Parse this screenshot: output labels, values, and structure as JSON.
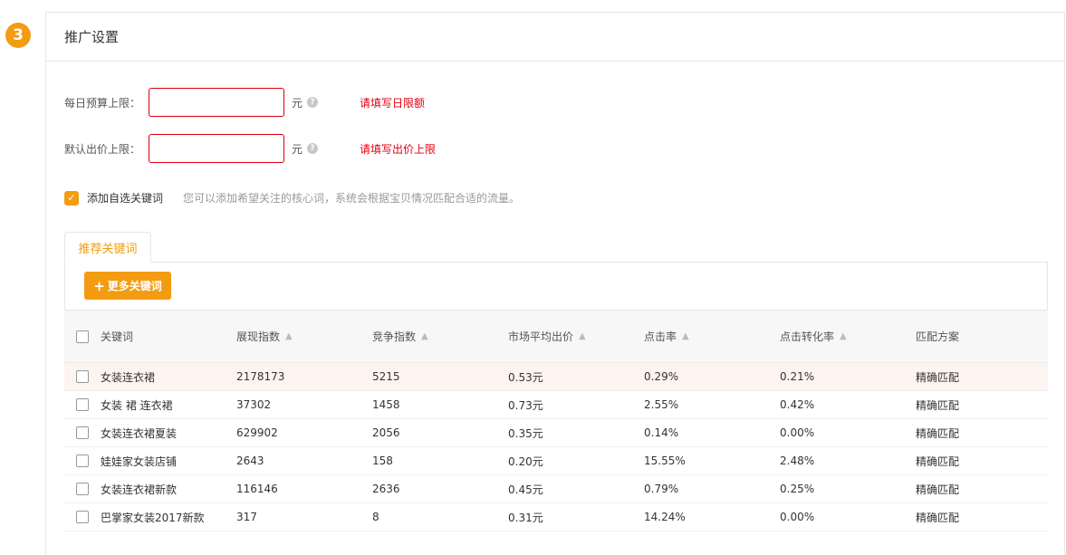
{
  "step": {
    "number": "3"
  },
  "panel": {
    "title": "推广设置"
  },
  "form": {
    "daily_budget": {
      "label": "每日预算上限：",
      "value": "",
      "unit": "元",
      "error": "请填写日限额"
    },
    "default_bid": {
      "label": "默认出价上限：",
      "value": "",
      "unit": "元",
      "error": "请填写出价上限"
    }
  },
  "custom_keywords": {
    "checked": true,
    "label": "添加自选关键词",
    "hint": "您可以添加希望关注的核心词，系统会根据宝贝情况匹配合适的流量。"
  },
  "tabs": [
    {
      "label": "推荐关键词",
      "active": true
    }
  ],
  "more_button": {
    "label": "更多关键词"
  },
  "table": {
    "headers": [
      "关键词",
      "展现指数",
      "竞争指数",
      "市场平均出价",
      "点击率",
      "点击转化率",
      "匹配方案"
    ],
    "rows": [
      [
        "女装连衣裙",
        "2178173",
        "5215",
        "0.53元",
        "0.29%",
        "0.21%",
        "精确匹配"
      ],
      [
        "女装 裙 连衣裙",
        "37302",
        "1458",
        "0.73元",
        "2.55%",
        "0.42%",
        "精确匹配"
      ],
      [
        "女装连衣裙夏装",
        "629902",
        "2056",
        "0.35元",
        "0.14%",
        "0.00%",
        "精确匹配"
      ],
      [
        "娃娃家女装店铺",
        "2643",
        "158",
        "0.20元",
        "15.55%",
        "2.48%",
        "精确匹配"
      ],
      [
        "女装连衣裙新款",
        "116146",
        "2636",
        "0.45元",
        "0.79%",
        "0.25%",
        "精确匹配"
      ],
      [
        "巴掌家女装2017新款",
        "317",
        "8",
        "0.31元",
        "14.24%",
        "0.00%",
        "精确匹配"
      ]
    ]
  },
  "colors": {
    "accent": "#f39c12",
    "error": "#e4000f"
  }
}
